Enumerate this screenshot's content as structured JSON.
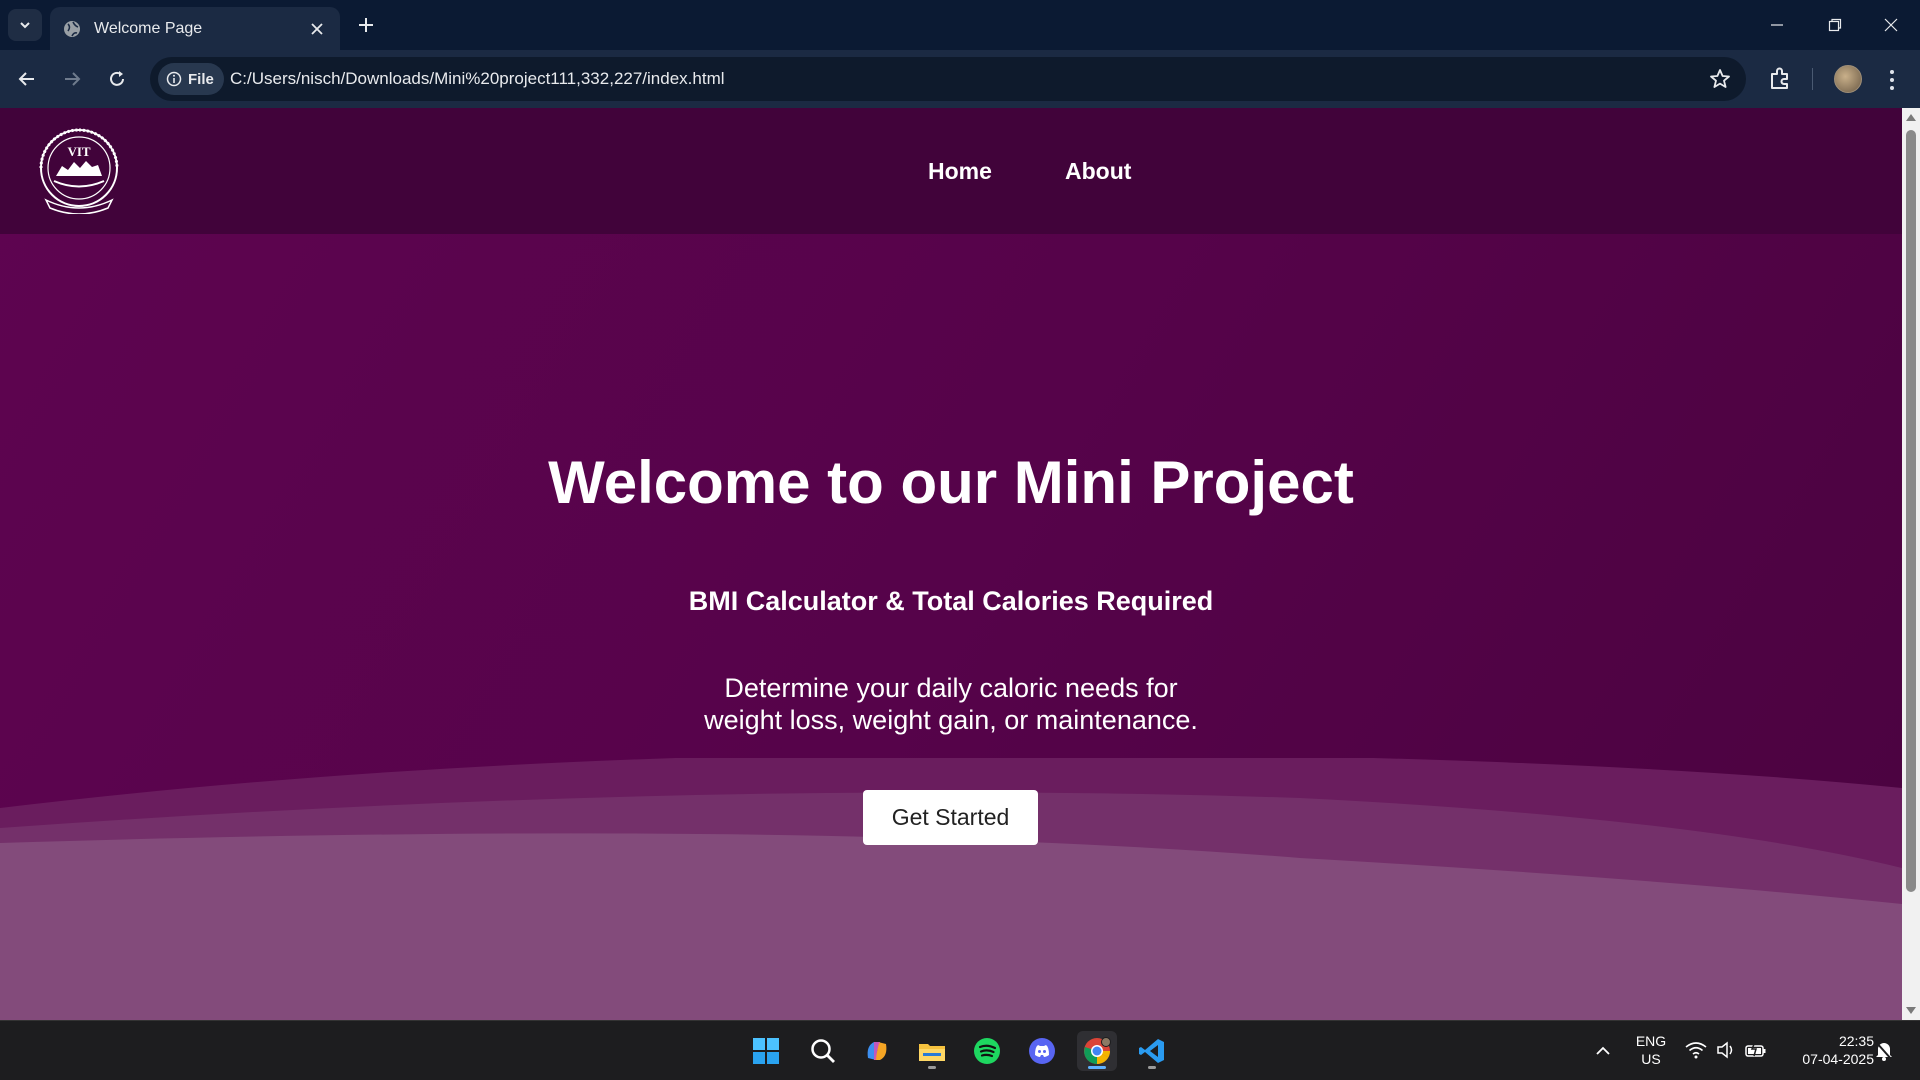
{
  "browser": {
    "tab_title": "Welcome Page",
    "chip_label": "File",
    "url": "C:/Users/nisch/Downloads/Mini%20project111,332,227/index.html"
  },
  "site": {
    "logo_text": "VIT",
    "nav": [
      {
        "label": "Home"
      },
      {
        "label": "About"
      }
    ]
  },
  "hero": {
    "title": "Welcome to our Mini Project",
    "subtitle": "BMI Calculator & Total Calories Required",
    "description_line1": "Determine your daily caloric needs for",
    "description_line2": "weight loss, weight gain, or maintenance.",
    "cta_label": "Get Started"
  },
  "taskbar": {
    "lang_line1": "ENG",
    "lang_line2": "US",
    "time": "22:35",
    "date": "07-04-2025",
    "apps": [
      "windows-start-icon",
      "search-icon",
      "copilot-icon",
      "file-explorer-icon",
      "spotify-icon",
      "discord-icon",
      "chrome-icon",
      "vscode-icon"
    ]
  },
  "colors": {
    "header_bg": "#41033a",
    "hero_bg": "#5a044c",
    "wave_light": "#834b7b",
    "cta_bg": "#ffffff"
  }
}
